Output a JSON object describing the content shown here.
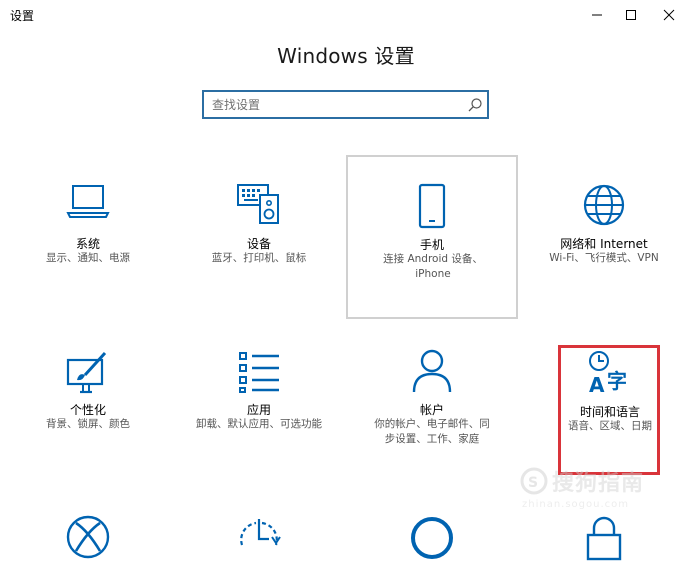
{
  "window": {
    "title": "设置",
    "minimize_icon": "minimize-icon",
    "maximize_icon": "maximize-icon",
    "close_icon": "close-icon"
  },
  "page": {
    "heading": "Windows 设置"
  },
  "search": {
    "placeholder": "查找设置",
    "icon": "search-icon"
  },
  "tiles": [
    {
      "name": "系统",
      "desc": "显示、通知、电源",
      "icon": "laptop-icon"
    },
    {
      "name": "设备",
      "desc": "蓝牙、打印机、鼠标",
      "icon": "devices-icon"
    },
    {
      "name": "手机",
      "desc": "连接 Android 设备、iPhone",
      "icon": "phone-icon"
    },
    {
      "name": "网络和 Internet",
      "desc": "Wi-Fi、飞行模式、VPN",
      "icon": "globe-icon"
    },
    {
      "name": "个性化",
      "desc": "背景、锁屏、颜色",
      "icon": "personalization-icon"
    },
    {
      "name": "应用",
      "desc": "卸载、默认应用、可选功能",
      "icon": "apps-list-icon"
    },
    {
      "name": "帐户",
      "desc": "你的帐户、电子邮件、同步设置、工作、家庭",
      "icon": "person-icon"
    },
    {
      "name": "时间和语言",
      "desc": "语音、区域、日期",
      "icon": "time-language-icon"
    }
  ],
  "bottom_row_icons": [
    "xbox-icon",
    "update-icon",
    "cortana-icon",
    "lock-icon"
  ],
  "watermark": {
    "text": "搜狗指南",
    "url": "zhinan.sogou.com"
  },
  "colors": {
    "accent": "#0063b1",
    "highlight_box": "#d9343a",
    "search_border": "#2b6ea3"
  }
}
